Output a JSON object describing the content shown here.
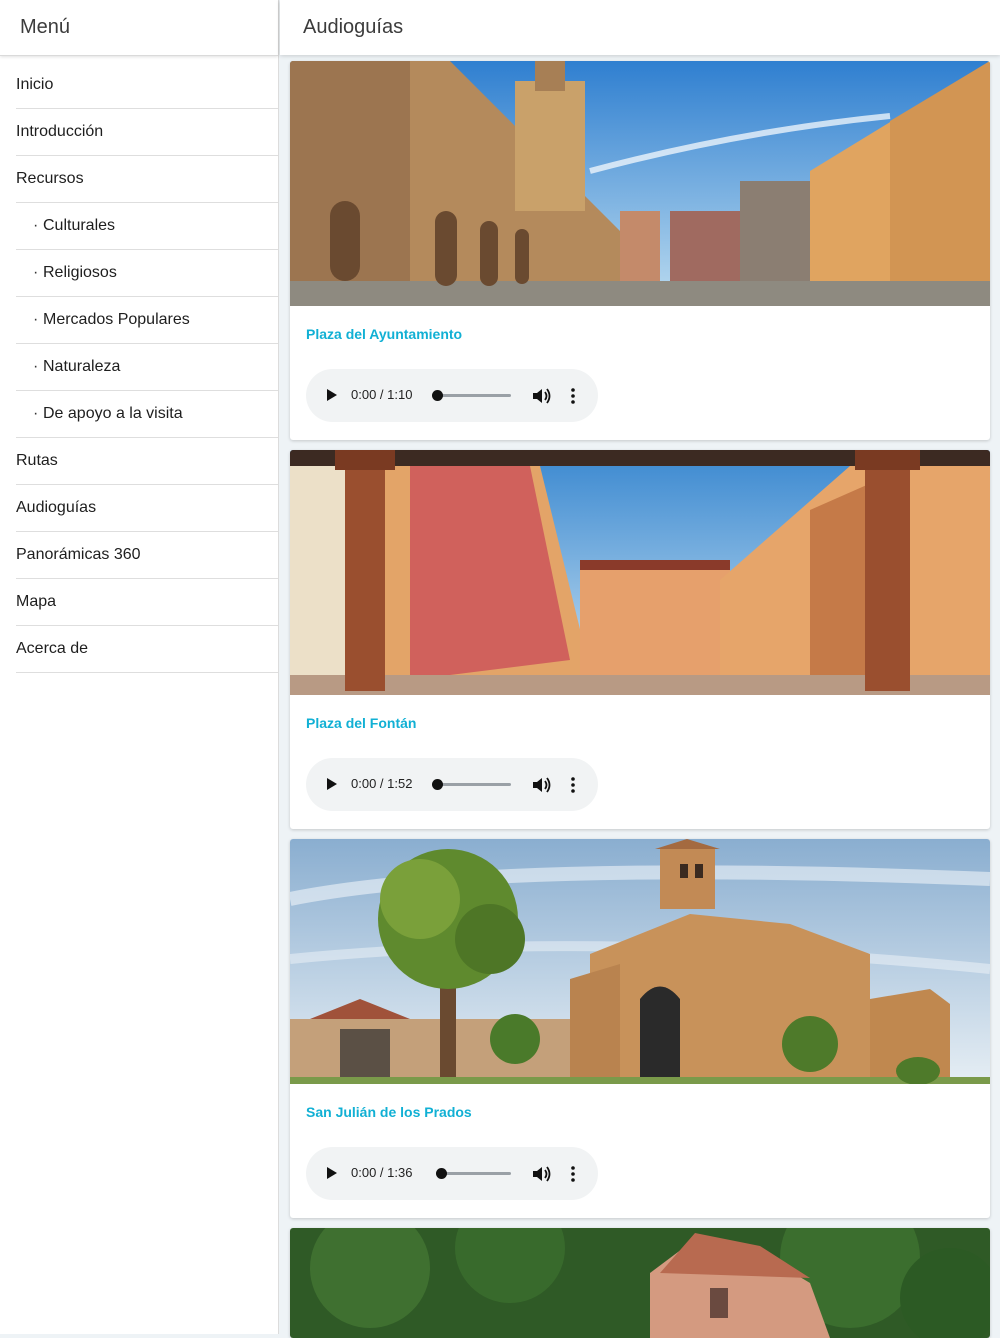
{
  "sidebar": {
    "title": "Menú",
    "items": [
      {
        "label": "Inicio",
        "sub": false
      },
      {
        "label": "Introducción",
        "sub": false
      },
      {
        "label": "Recursos",
        "sub": false
      },
      {
        "label": "Culturales",
        "sub": true
      },
      {
        "label": "Religiosos",
        "sub": true
      },
      {
        "label": "Mercados Populares",
        "sub": true
      },
      {
        "label": "Naturaleza",
        "sub": true
      },
      {
        "label": "De apoyo a la visita",
        "sub": true
      },
      {
        "label": "Rutas",
        "sub": false
      },
      {
        "label": "Audioguías",
        "sub": false
      },
      {
        "label": "Panorámicas 360",
        "sub": false
      },
      {
        "label": "Mapa",
        "sub": false
      },
      {
        "label": "Acerca de",
        "sub": false
      }
    ]
  },
  "header": {
    "title": "Audioguías"
  },
  "cards": [
    {
      "title": "Plaza del Ayuntamiento",
      "time": "0:00 / 1:10",
      "progress": 0
    },
    {
      "title": "Plaza del Fontán",
      "time": "0:00 / 1:52",
      "progress": 0
    },
    {
      "title": "San Julián de los Prados",
      "time": "0:00 / 1:36",
      "progress": 0.05
    }
  ],
  "colors": {
    "accent": "#11b0d4",
    "background": "#eef3f6"
  }
}
